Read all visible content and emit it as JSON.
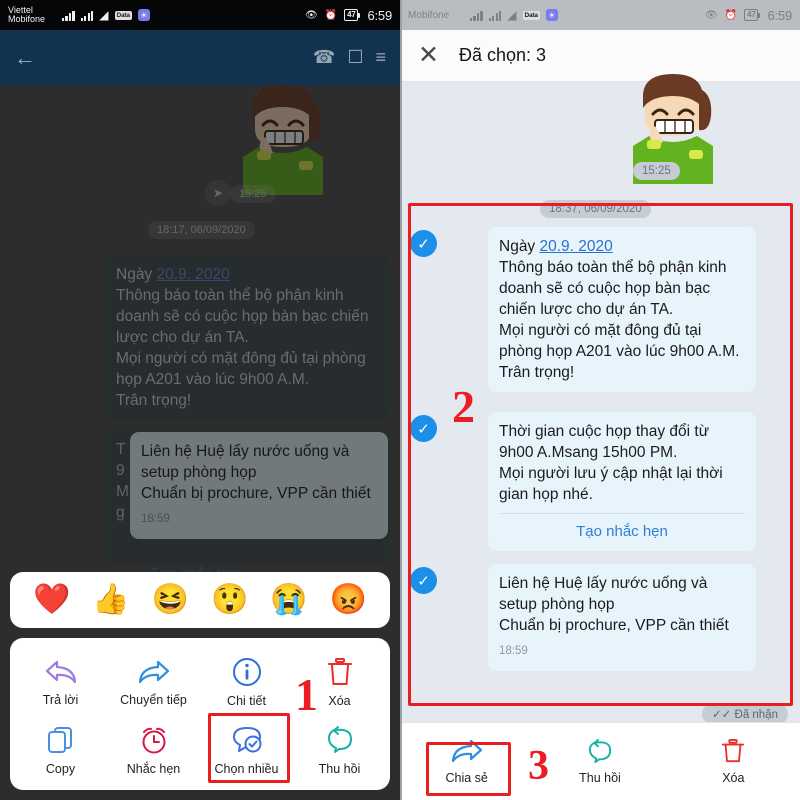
{
  "left": {
    "statusbar": {
      "carrier": "Viettel\nMobifone",
      "signal1": "signal-bars-icon",
      "signal2": "signal-bars-icon",
      "wifi": "wifi-icon",
      "chip_label": "Data",
      "app_badge": "app-icon",
      "eye": "eye-icon",
      "alarm": "alarm-icon",
      "battery": "47",
      "time": "6:59"
    },
    "header": {
      "back": "back-arrow-icon",
      "call": "phone-icon",
      "video": "video-camera-icon",
      "menu": "list-menu-icon"
    },
    "chat": {
      "forward_icon": "forward-icon",
      "sticker": "cartoon-boy-sticker",
      "time_sticker": "15:25",
      "date_divider": "18:17, 06/09/2020",
      "msg1": {
        "prefix": "Ngày ",
        "link": "20.9. 2020",
        "body": "Thông báo toàn thể bộ phận kinh doanh sẽ có cuộc họp bàn bạc chiến lược cho dự án TA.\nMọi người có mặt đông đủ tại phòng họp A201 vào lúc 9h00 A.M.\nTrân trọng!"
      },
      "msg2": {
        "body": "Liên hệ Huệ lấy nước uống và setup phòng họp\nChuẩn bị prochure, VPP cần thiết",
        "time": "18:59"
      },
      "hidden_reminder": "Tạo nhắc hẹn"
    },
    "emoji_bar": [
      {
        "name": "heart-emoji",
        "glyph": "❤️"
      },
      {
        "name": "thumbs-up-emoji",
        "glyph": "👍"
      },
      {
        "name": "laughing-emoji",
        "glyph": "😆"
      },
      {
        "name": "surprised-emoji",
        "glyph": "😲"
      },
      {
        "name": "crying-emoji",
        "glyph": "😭"
      },
      {
        "name": "angry-emoji",
        "glyph": "😡"
      }
    ],
    "actions": [
      {
        "label": "Trả lời",
        "icon": "reply-icon",
        "color": "#9b7ee0"
      },
      {
        "label": "Chuyển tiếp",
        "icon": "forward-icon",
        "color": "#2f8fe0"
      },
      {
        "label": "Chi tiết",
        "icon": "info-circle-icon",
        "color": "#2f6fd4"
      },
      {
        "label": "Xóa",
        "icon": "trash-icon",
        "color": "#e8302a"
      },
      {
        "label": "Copy",
        "icon": "copy-icon",
        "color": "#4a90e2"
      },
      {
        "label": "Nhắc hẹn",
        "icon": "alarm-clock-icon",
        "color": "#d6194c"
      },
      {
        "label": "Chọn nhiều",
        "icon": "multi-select-icon",
        "color": "#3d6fe0"
      },
      {
        "label": "Thu hồi",
        "icon": "recall-icon",
        "color": "#17b0a8"
      }
    ],
    "marker": "1"
  },
  "right": {
    "statusbar": {
      "carrier": "Mobifone",
      "chip_label": "Data",
      "battery": "47",
      "time": "6:59"
    },
    "header": {
      "close": "close-x-icon",
      "title": "Đã chọn: 3"
    },
    "chat": {
      "sticker": "cartoon-boy-sticker",
      "time_sticker": "15:25",
      "date_divider": "18:37, 06/09/2020",
      "msg1": {
        "prefix": "Ngày ",
        "link": "20.9. 2020",
        "body": "Thông báo toàn thể bộ phận kinh doanh sẽ có cuộc họp bàn bạc chiến lược cho dự án TA.\nMọi người có mặt đông đủ tại phòng họp A201 vào lúc 9h00 A.M.\nTrân trọng!"
      },
      "msg2": {
        "body": "Thời gian cuộc họp thay đổi từ 9h00 A.Msang 15h00 PM.\nMọi người lưu ý cập nhật lại thời gian họp nhé.",
        "reminder": "Tạo nhắc hẹn"
      },
      "msg3": {
        "body": "Liên hệ Huệ lấy nước uống và setup phòng họp\nChuẩn bị prochure, VPP cần thiết",
        "time": "18:59"
      },
      "receipt": "Đã nhận",
      "receipt_icon": "double-check-icon",
      "checkbox_icon": "check-circle-icon",
      "checked_count": 3
    },
    "bottom_bar": [
      {
        "label": "Chia sẻ",
        "icon": "share-forward-icon",
        "color": "#2f8fe0"
      },
      {
        "label": "Thu hồi",
        "icon": "recall-icon",
        "color": "#17b0a8"
      },
      {
        "label": "Xóa",
        "icon": "trash-icon",
        "color": "#e8302a"
      }
    ],
    "markers": {
      "selection": "2",
      "bottom": "3"
    }
  },
  "colors": {
    "accent_red": "#ec1c24",
    "check_blue": "#1c8fe8",
    "bubble_blue": "#e5f3fb",
    "header_navy": "#12334f"
  }
}
